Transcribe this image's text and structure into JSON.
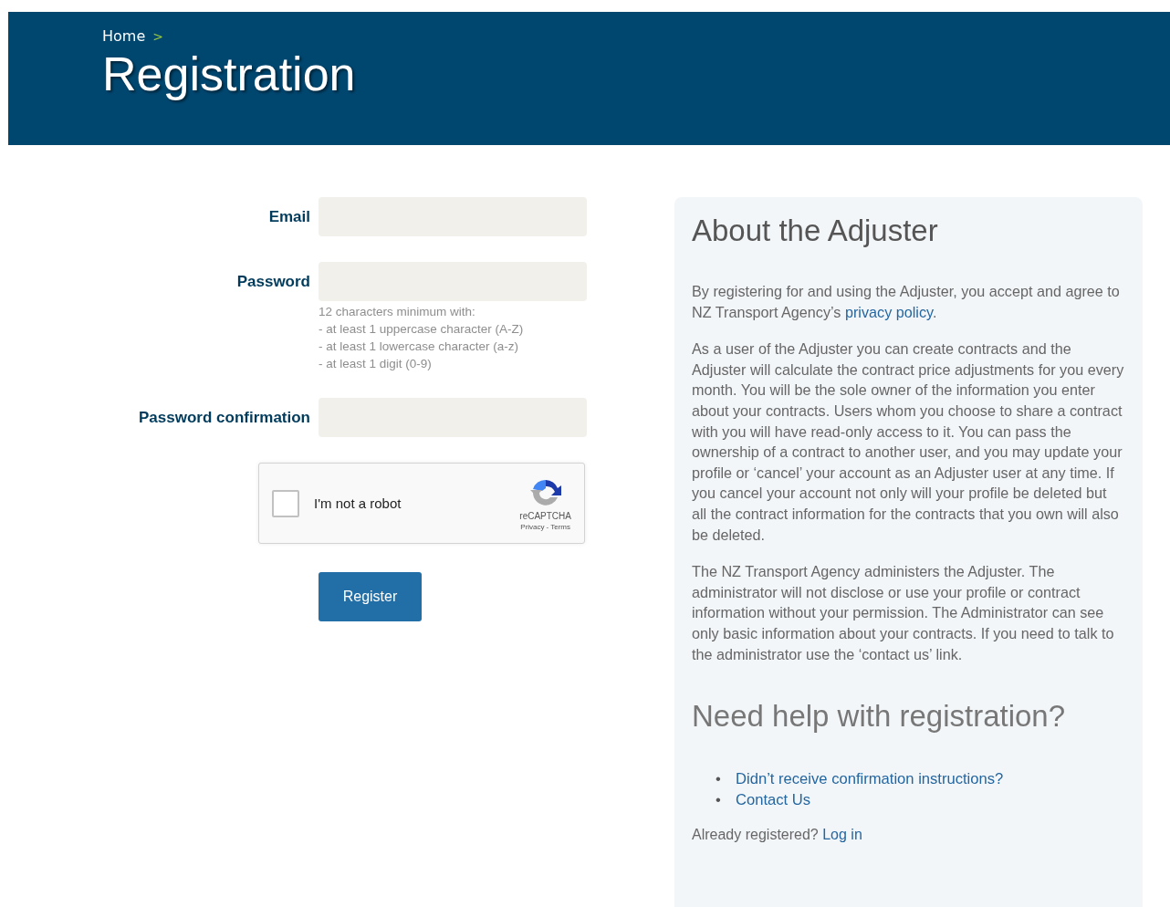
{
  "breadcrumb": {
    "items": [
      "Home"
    ],
    "separator": ">"
  },
  "page_title": "Registration",
  "form": {
    "fields": [
      {
        "label": "Email"
      },
      {
        "label": "Password",
        "hint": [
          "12 characters minimum with:",
          "- at least 1 uppercase character (A-Z)",
          "- at least 1 lowercase character (a-z)",
          "- at least 1 digit (0-9)"
        ]
      },
      {
        "label": "Password confirmation"
      }
    ],
    "captcha": {
      "label": "I'm not a robot",
      "checked": false,
      "brand": "reCAPTCHA",
      "privacy": "Privacy",
      "separator": "-",
      "terms": "Terms"
    },
    "submit": "Register"
  },
  "about": {
    "title": "About the Adjuster",
    "paragraphs": [
      {
        "parts": [
          {
            "kind": "text",
            "text": "By registering for and using the Adjuster, you accept and agree to NZ Transport Agency’s "
          },
          {
            "kind": "link",
            "text": "privacy policy"
          },
          {
            "kind": "text",
            "text": "."
          }
        ]
      },
      {
        "parts": [
          {
            "kind": "text",
            "text": "As a user of the Adjuster you can create contracts and the Adjuster will calculate the contract price adjustments for you every month. You will be the sole owner of the information you enter about your contracts. Users whom you choose to share a contract with you will have read-only access to it. You can pass the ownership of a contract to another user, and you may update your profile or ‘cancel’ your account as an Adjuster user at any time. If you cancel your account not only will your profile be deleted but all the contract information for the contracts that you own will also be deleted."
          }
        ]
      },
      {
        "parts": [
          {
            "kind": "text",
            "text": "The NZ Transport Agency administers the Adjuster. The administrator will not disclose or use your profile or contract information without your permission. The Administrator can see only basic information about your contracts. If you need to talk to the administrator use the ‘contact us’ link."
          }
        ]
      }
    ],
    "help_title": "Need help with registration?",
    "help_links": [
      {
        "bullet": "•",
        "text": "Didn’t receive confirmation instructions?"
      },
      {
        "bullet": "•",
        "text": "Contact Us"
      }
    ],
    "login": {
      "text": "Already registered?",
      "link": "Log in"
    }
  }
}
